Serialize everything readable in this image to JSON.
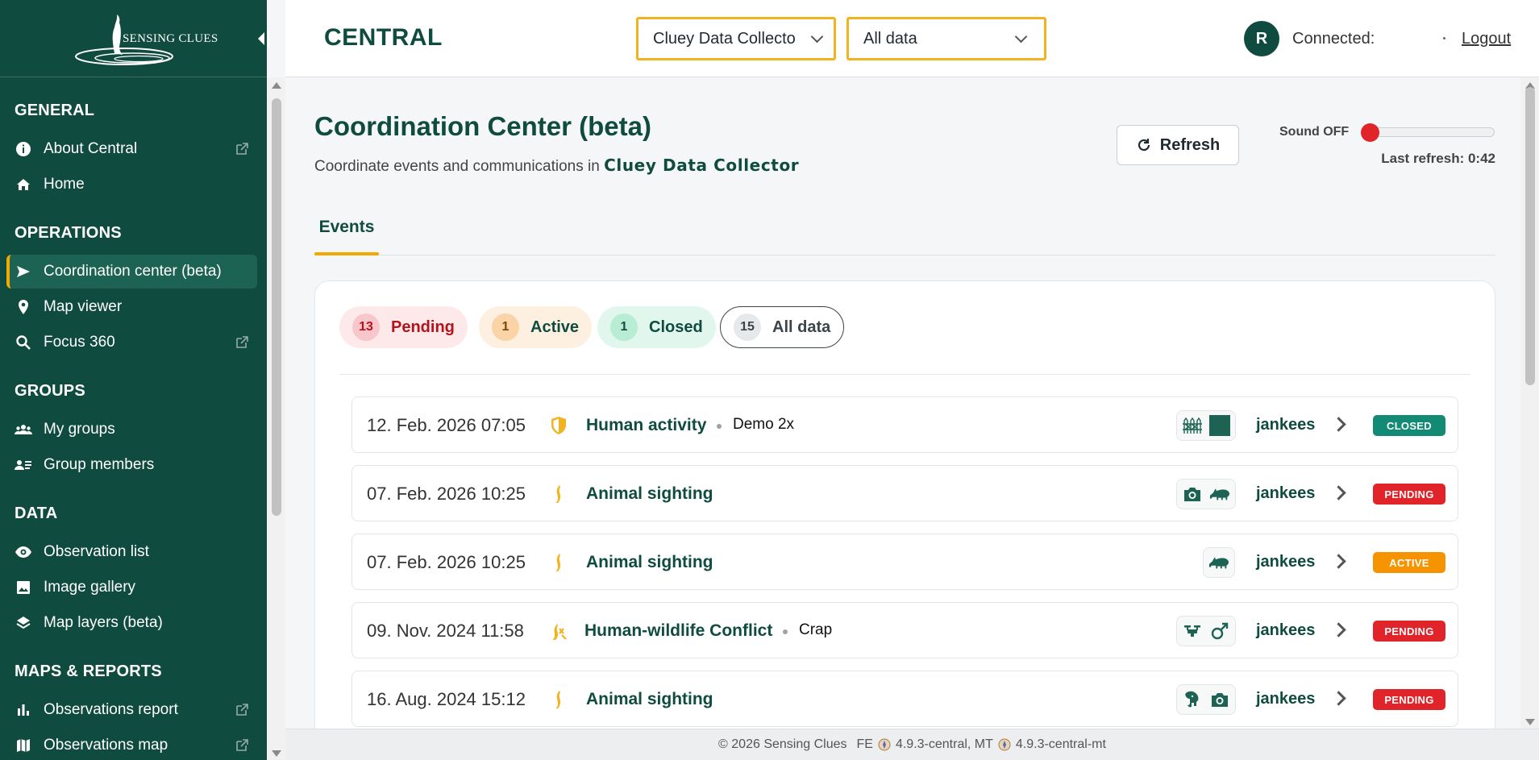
{
  "sidebar": {
    "logo_text": "SENSING CLUES",
    "sections": [
      {
        "title": "GENERAL",
        "items": [
          {
            "label": "About Central",
            "icon": "info-icon",
            "external": true
          },
          {
            "label": "Home",
            "icon": "home-icon",
            "external": false
          }
        ]
      },
      {
        "title": "OPERATIONS",
        "items": [
          {
            "label": "Coordination center (beta)",
            "icon": "send-icon",
            "external": false,
            "active": true
          },
          {
            "label": "Map viewer",
            "icon": "map-pin-icon",
            "external": false
          },
          {
            "label": "Focus 360",
            "icon": "search-icon",
            "external": true
          }
        ]
      },
      {
        "title": "GROUPS",
        "items": [
          {
            "label": "My groups",
            "icon": "groups-icon",
            "external": false
          },
          {
            "label": "Group members",
            "icon": "group-members-icon",
            "external": false
          }
        ]
      },
      {
        "title": "DATA",
        "items": [
          {
            "label": "Observation list",
            "icon": "eye-icon",
            "external": false
          },
          {
            "label": "Image gallery",
            "icon": "image-icon",
            "external": false
          },
          {
            "label": "Map layers (beta)",
            "icon": "layers-icon",
            "external": false
          }
        ]
      },
      {
        "title": "MAPS & REPORTS",
        "items": [
          {
            "label": "Observations report",
            "icon": "bar-chart-icon",
            "external": true
          },
          {
            "label": "Observations map",
            "icon": "map-icon",
            "external": true
          }
        ]
      }
    ]
  },
  "topbar": {
    "brand": "CENTRAL",
    "group_select": "Cluey Data Collecto",
    "data_select": "All data",
    "avatar_initial": "R",
    "connected_label": "Connected:",
    "logout_label": "Logout"
  },
  "main": {
    "title": "Coordination Center (beta)",
    "subtitle_prefix": "Coordinate events and communications in",
    "subtitle_group": "Cluey Data Collector",
    "refresh_label": "Refresh",
    "sound_label": "Sound OFF",
    "last_refresh": "Last refresh: 0:42",
    "tab_label": "Events",
    "filters": [
      {
        "count": "13",
        "label": "Pending"
      },
      {
        "count": "1",
        "label": "Active"
      },
      {
        "count": "1",
        "label": "Closed"
      },
      {
        "count": "15",
        "label": "All data"
      }
    ],
    "events": [
      {
        "date": "12. Feb. 2026 07:05",
        "type": "Human activity",
        "type_icon": "shield-icon",
        "note": "Demo 2x",
        "icons": [
          "fence-icon",
          "square-icon"
        ],
        "user": "jankees",
        "status": "CLOSED"
      },
      {
        "date": "07. Feb. 2026 10:25",
        "type": "Animal sighting",
        "type_icon": "meerkat-icon",
        "note": "",
        "icons": [
          "camera-icon",
          "rhino-icon"
        ],
        "user": "jankees",
        "status": "PENDING"
      },
      {
        "date": "07. Feb. 2026 10:25",
        "type": "Animal sighting",
        "type_icon": "meerkat-icon",
        "note": "",
        "icons": [
          "rhino-icon"
        ],
        "user": "jankees",
        "status": "ACTIVE"
      },
      {
        "date": "09. Nov. 2024 11:58",
        "type": "Human-wildlife Conflict",
        "type_icon": "conflict-icon",
        "note": "Crap",
        "icons": [
          "drone-icon",
          "male-icon"
        ],
        "user": "jankees",
        "status": "PENDING"
      },
      {
        "date": "16. Aug. 2024 15:12",
        "type": "Animal sighting",
        "type_icon": "meerkat-icon",
        "note": "",
        "icons": [
          "elephant-icon",
          "camera-icon"
        ],
        "user": "jankees",
        "status": "PENDING"
      }
    ]
  },
  "footer": {
    "copyright": "© 2026 Sensing Clues",
    "fe_label": "FE",
    "fe_version": "4.9.3-central, MT",
    "mt_version": "4.9.3-central-mt"
  },
  "colors": {
    "brand_green": "#0f4b3f",
    "accent": "#f2a900",
    "pending": "#e0242a",
    "active": "#f59300",
    "closed": "#138a74"
  }
}
